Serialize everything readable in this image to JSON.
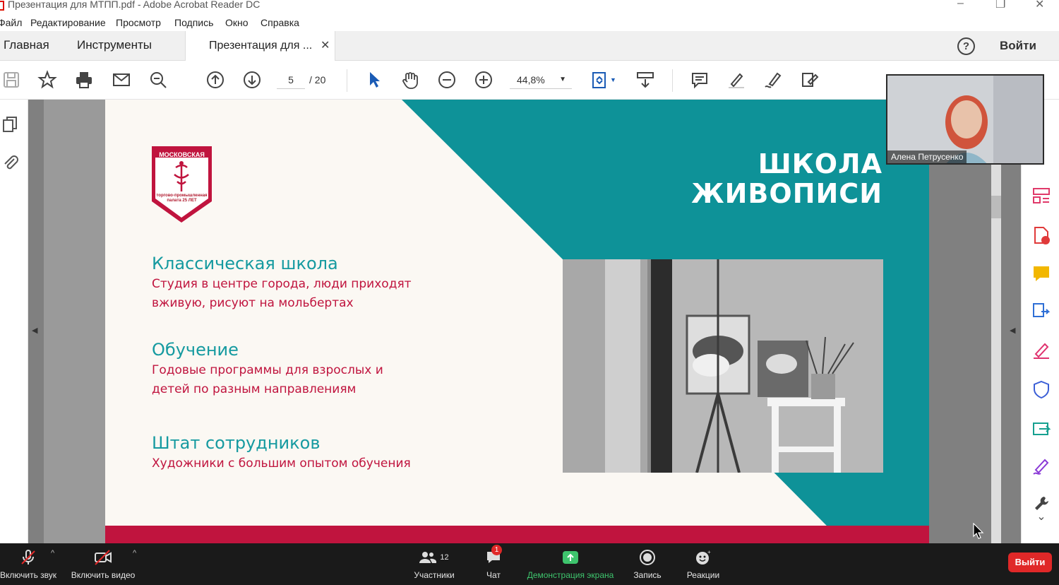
{
  "window": {
    "title": "Презентация для МТПП.pdf - Adobe Acrobat Reader DC"
  },
  "menu": [
    "Файл",
    "Редактирование",
    "Просмотр",
    "Подпись",
    "Окно",
    "Справка"
  ],
  "tabs": {
    "home": "Главная",
    "tools": "Инструменты",
    "document": "Презентация для ...",
    "help": "?",
    "login": "Войти"
  },
  "toolbar": {
    "current_page": "5",
    "total_pages": "/ 20",
    "zoom": "44,8%"
  },
  "slide": {
    "title_line1": "ШКОЛА",
    "title_line2": "ЖИВОПИСИ",
    "logo_top": "МОСКОВСКАЯ",
    "logo_bottom": "торгово-промышленная палата 25 ЛЕТ",
    "sections": [
      {
        "heading": "Классическая школа",
        "text1": "Студия в центре города, люди приходят",
        "text2": "вживую, рисуют на мольбертах"
      },
      {
        "heading": "Обучение",
        "text1": "Годовые программы для взрослых и",
        "text2": "детей по разным направлениям"
      },
      {
        "heading": "Штат сотрудников",
        "text1": "Художники с большим опытом обучения",
        "text2": ""
      }
    ]
  },
  "video": {
    "participant_name": "Алена Петрусенко"
  },
  "meeting": {
    "unmute": "Включить звук",
    "start_video": "Включить видео",
    "participants": "Участники",
    "participants_count": "12",
    "chat": "Чат",
    "chat_badge": "1",
    "share": "Демонстрация экрана",
    "record": "Запись",
    "reactions": "Реакции",
    "leave": "Выйти"
  },
  "colors": {
    "teal": "#0e9298",
    "crimson": "#c0143e",
    "share_green": "#3ec46d",
    "leave_red": "#e02828"
  }
}
